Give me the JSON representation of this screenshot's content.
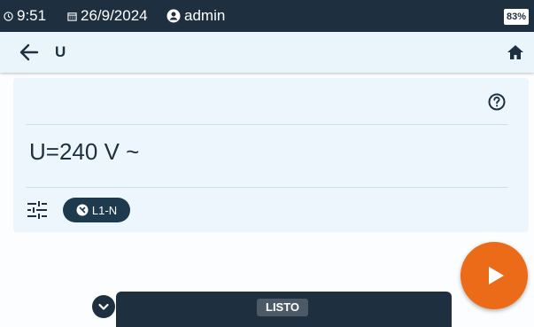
{
  "statusbar": {
    "time": "9:51",
    "date": "26/9/2024",
    "user": "admin",
    "battery": "83%",
    "icons": [
      "clock-icon",
      "calendar-icon",
      "user-icon"
    ]
  },
  "header": {
    "title": "U",
    "back_icon": "arrow-left-icon",
    "home_icon": "home-icon"
  },
  "card": {
    "reading": "U=240 V ~",
    "help_icon": "help-circle-icon",
    "settings_icon": "sliders-icon",
    "chip_label": "L1-N",
    "chip_icon": "probe-icon"
  },
  "actions": {
    "play_icon": "play-icon",
    "expand_icon": "chevron-down-icon"
  },
  "bottom": {
    "status": "LISTO"
  },
  "colors": {
    "bar": "#1e3040",
    "header": "#e9f4fb",
    "card": "#ecf6fc",
    "accent": "#ec6b19"
  }
}
